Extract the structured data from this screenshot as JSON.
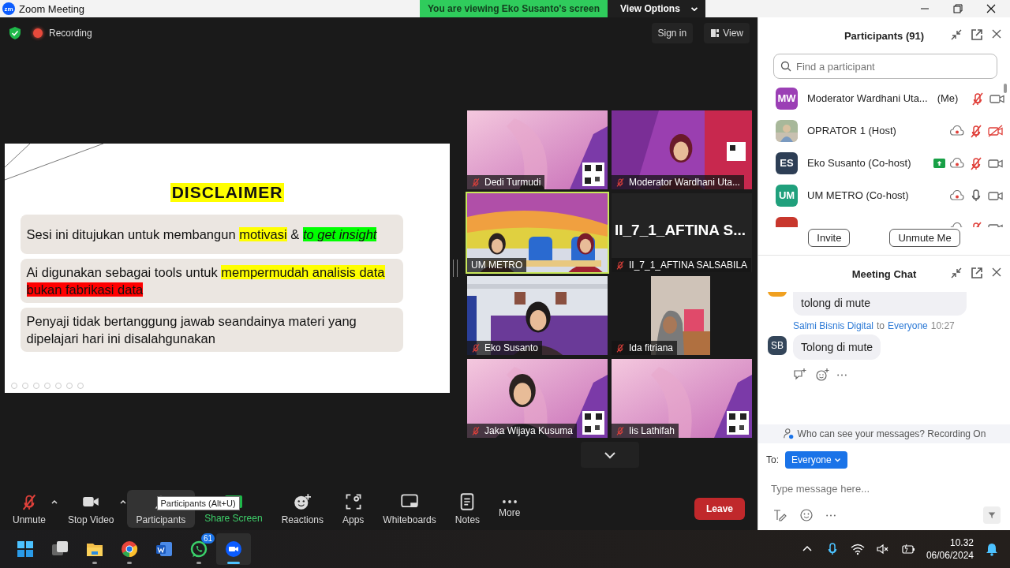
{
  "window": {
    "logo": "zm",
    "title": "Zoom Meeting"
  },
  "share_banner": {
    "message": "You are viewing Eko Susanto's screen",
    "options": "View Options"
  },
  "stage_bar": {
    "recording": "Recording",
    "sign_in": "Sign in",
    "view": "View"
  },
  "slide": {
    "heading": "DISCLAIMER",
    "points": [
      {
        "segments": [
          {
            "text": "Sesi ini ditujukan untuk membangun ",
            "italic": false
          },
          {
            "text": "motivasi",
            "color": "#ffff00",
            "italic": false
          },
          {
            "text": " & ",
            "italic": false
          },
          {
            "text": "to get insight",
            "color": "#00ff00",
            "italic": true
          }
        ]
      },
      {
        "segments": [
          {
            "text": "Ai digunakan sebagai tools untuk ",
            "italic": false
          },
          {
            "text": "mempermudah analisis data ",
            "color": "#ffff00",
            "italic": false
          },
          {
            "text": "bukan fabrikasi data",
            "color": "#ff0000",
            "italic": false
          }
        ]
      },
      {
        "segments": [
          {
            "text": "Penyaji tidak bertanggung jawab seandainya materi yang dipelajari hari ini disalahgunakan",
            "italic": false
          }
        ]
      }
    ]
  },
  "tiles": [
    {
      "kind": "picture",
      "name": "Dedi Turmudi",
      "muted": true,
      "selected": false
    },
    {
      "kind": "picture",
      "name": "Moderator Wardhani Uta...",
      "muted": true,
      "selected": false
    },
    {
      "kind": "picture",
      "name": "UM METRO",
      "muted": false,
      "selected": true
    },
    {
      "kind": "name",
      "display": "II_7_1_AFTINA  S...",
      "name": "II_7_1_AFTINA SALSABILA",
      "muted": true,
      "selected": false
    },
    {
      "kind": "picture",
      "name": "Eko Susanto",
      "muted": true,
      "selected": false
    },
    {
      "kind": "picture",
      "name": "Ida fitriana",
      "muted": true,
      "selected": false
    },
    {
      "kind": "picture",
      "name": "Jaka Wijaya Kusuma",
      "muted": true,
      "selected": false
    },
    {
      "kind": "picture",
      "name": "Iis Lathifah",
      "muted": true,
      "selected": false
    }
  ],
  "participants": {
    "title": "Participants (91)",
    "search_placeholder": "Find a participant",
    "people": [
      {
        "kind": "initials",
        "initials": "MW",
        "color": "#9b3fb5",
        "name": "Moderator Wardhani Uta...",
        "tag": "(Me)",
        "sharing": false,
        "recording": false,
        "mic_muted": true,
        "video_off": false
      },
      {
        "name": "OPRATOR 1 (Host)",
        "sharing": false,
        "recording": true,
        "mic_muted": true,
        "video_off": true
      },
      {
        "kind": "initials",
        "initials": "ES",
        "color": "#2d3e55",
        "name": "Eko Susanto (Co-host)",
        "sharing": true,
        "recording": true,
        "mic_muted": true,
        "video_off": false
      },
      {
        "kind": "initials",
        "initials": "UM",
        "color": "#20a07c",
        "name": "UM METRO (Co-host)",
        "sharing": false,
        "recording": true,
        "mic_muted": false,
        "video_off": false
      },
      {
        "kind": "initials",
        "color": "#c8372d",
        "sharing": false,
        "recording": true,
        "mic_muted": true,
        "video_off": false
      }
    ],
    "buttons": [
      "Invite",
      "Unmute Me"
    ]
  },
  "chat": {
    "title": "Meeting Chat",
    "messages": [
      {
        "color": "#f0a020",
        "text": "tolong di mute"
      },
      {
        "sender": "Salmi Bisnis Digital",
        "to": "to",
        "recipient": "Everyone",
        "time": "10:27",
        "initials": "SB",
        "color": "#34465a",
        "text": "Tolong di mute"
      }
    ],
    "notice": "Who can see your messages? Recording On",
    "to_label": "To:",
    "recipient": "Everyone",
    "placeholder": "Type message here..."
  },
  "toolbar": {
    "items": [
      {
        "kind": "plain",
        "label": "Unmute",
        "menu": true,
        "selected": false
      },
      {
        "kind": "plain",
        "label": "Stop Video",
        "menu": true,
        "selected": false
      },
      {
        "kind": "plain",
        "label": "Participants",
        "menu": false,
        "selected": true,
        "tooltip": "Participants (Alt+U)"
      },
      {
        "kind": "share",
        "label": "Share Screen",
        "menu": false,
        "selected": false
      },
      {
        "kind": "plain",
        "label": "Reactions",
        "menu": false,
        "selected": false
      },
      {
        "kind": "plain",
        "label": "Apps",
        "menu": false,
        "selected": false
      },
      {
        "kind": "plain",
        "label": "Whiteboards",
        "menu": false,
        "selected": false
      },
      {
        "kind": "plain",
        "label": "Notes",
        "menu": false,
        "selected": false
      },
      {
        "kind": "plain",
        "label": "More",
        "menu": false,
        "selected": false
      }
    ],
    "leave": "Leave"
  },
  "taskbar": {
    "apps": [
      {
        "running": false,
        "selected": false
      },
      {
        "running": false,
        "selected": false
      },
      {
        "running": true,
        "selected": false
      },
      {
        "running": true,
        "selected": false
      },
      {
        "running": false,
        "selected": false
      },
      {
        "running": true,
        "selected": false,
        "badge": "61"
      },
      {
        "running": true,
        "selected": true
      }
    ],
    "time": "10.32",
    "date": "06/06/2024"
  }
}
